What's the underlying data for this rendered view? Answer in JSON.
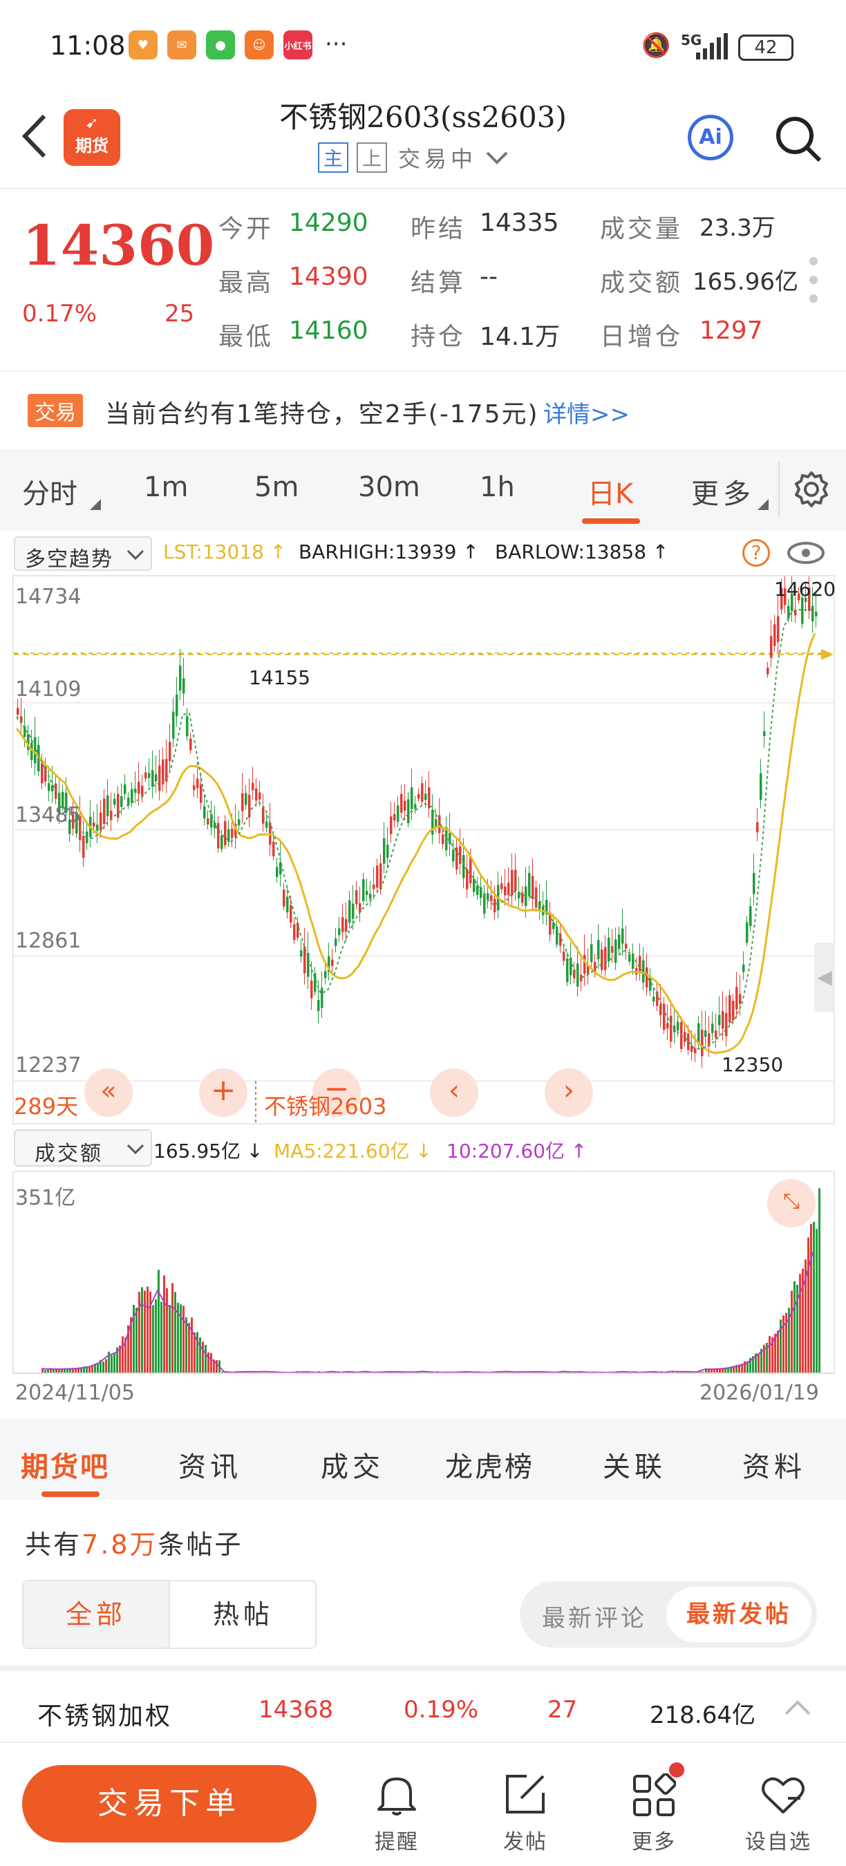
{
  "status": {
    "time": "11:08",
    "network": "5G",
    "battery": "42",
    "more": "···",
    "apps": [
      "heart-app-icon",
      "mail-app-icon",
      "wechat-app-icon",
      "taobao-app-icon",
      "xiaohongshu-app-icon"
    ],
    "app_label_small": "小红书"
  },
  "header": {
    "title": "不锈钢2603(ss2603)",
    "tag_main": "主",
    "tag_up": "上",
    "status": "交易中",
    "logo_text": "期货",
    "ai_label": "Ai"
  },
  "quote": {
    "price": "14360",
    "change_pct": "0.17%",
    "change": "25",
    "open_label": "今开",
    "open": "14290",
    "prev_settle_label": "昨结",
    "prev_settle": "14335",
    "volume_label": "成交量",
    "volume": "23.3万",
    "high_label": "最高",
    "high": "14390",
    "settle_label": "结算",
    "settle": "--",
    "amount_label": "成交额",
    "amount": "165.96亿",
    "low_label": "最低",
    "low": "14160",
    "oi_label": "持仓",
    "oi": "14.1万",
    "oi_change_label": "日增仓",
    "oi_change": "1297"
  },
  "trade_notice": {
    "badge": "交易",
    "text": "当前合约有1笔持仓，空2手(-175元)",
    "link": "详情>>"
  },
  "chart_tabs": [
    "分时",
    "1m",
    "5m",
    "30m",
    "1h",
    "日K",
    "更多"
  ],
  "active_chart_tab": "日K",
  "indicator": {
    "name": "多空趋势",
    "lst": "LST:13018 ↑",
    "barhigh": "BARHIGH:13939 ↑",
    "barlow": "BARLOW:13858 ↑"
  },
  "kline": {
    "y_labels": [
      "14734",
      "14109",
      "13485",
      "12861",
      "12237"
    ],
    "high_mark": "14620",
    "peak_mark": "14155",
    "low_mark": "12350",
    "days": "289天",
    "name": "不锈钢2603"
  },
  "volume_panel": {
    "name": "成交额",
    "value": "165.95亿 ↓",
    "ma5": "MA5:221.60亿 ↓",
    "ma10": "10:207.60亿 ↑",
    "max_label": "351亿",
    "start_date": "2024/11/05",
    "end_date": "2026/01/19"
  },
  "sections": [
    "期货吧",
    "资讯",
    "成交",
    "龙虎榜",
    "关联",
    "资料"
  ],
  "posts": {
    "prefix": "共有",
    "count": "7.8万",
    "suffix": "条帖子",
    "all": "全部",
    "hot": "热帖",
    "latest_comment": "最新评论",
    "latest_post": "最新发帖"
  },
  "weighted": {
    "name": "不锈钢加权",
    "price": "14368",
    "pct": "0.19%",
    "change": "27",
    "amount": "218.64亿"
  },
  "bottom": {
    "order": "交易下单",
    "remind": "提醒",
    "post": "发帖",
    "more": "更多",
    "watch": "设自选"
  },
  "colors": {
    "up": "#e33b36",
    "down": "#1f9d3a",
    "accent": "#ee5a24",
    "ma": "#e8b923",
    "purple": "#b43cc4"
  }
}
